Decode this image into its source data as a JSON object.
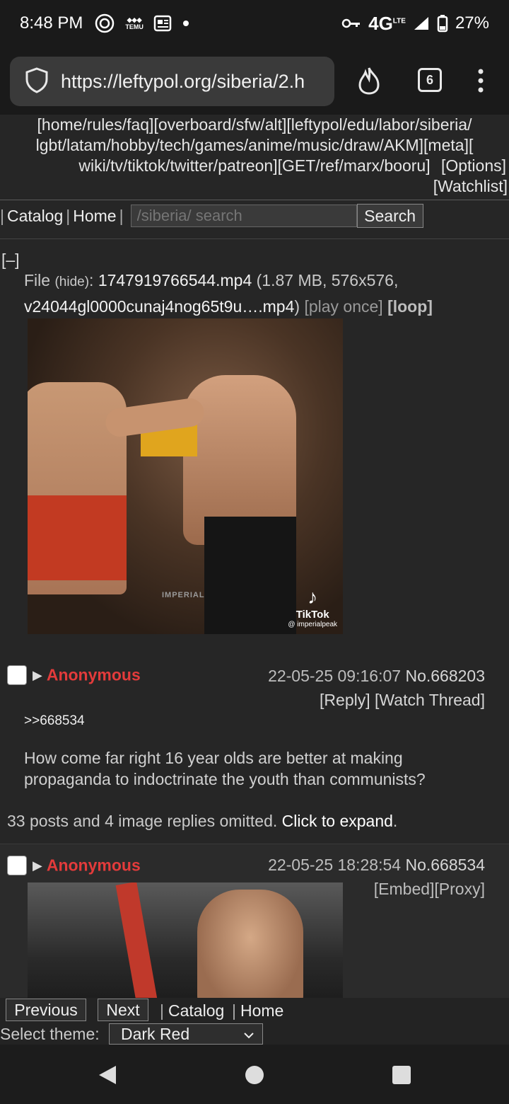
{
  "status_bar": {
    "time": "8:48 PM",
    "network": "4G",
    "network_sup": "LTE",
    "battery": "27%",
    "notif_temu": "TEMU",
    "icons": [
      "pinwheel-icon",
      "temu-icon",
      "news-icon",
      "dot-icon",
      "key-icon",
      "signal-icon",
      "battery-icon"
    ]
  },
  "browser": {
    "url": "https://leftypol.org/siberia/2.h",
    "tab_count": "6"
  },
  "boardlist": {
    "line1": "[home/rules/faq][overboard/sfw/alt][leftypol/edu/labor/siberia/",
    "line2": "lgbt/latam/hobby/tech/games/anime/music/draw/AKM][meta][",
    "line3": "wiki/tv/tiktok/twitter/patreon][GET/ref/marx/booru]",
    "options": "[Options]",
    "watchlist": "[Watchlist]"
  },
  "nav": {
    "lead_sep": "|",
    "catalog": "Catalog",
    "sep": "|",
    "home": "Home",
    "trail_sep": "|",
    "search_placeholder": "/siberia/ search",
    "search_button": "Search"
  },
  "thread": {
    "collapse": "[–]",
    "file_label": "File",
    "file_hide": "(hide)",
    "file_colon": ":",
    "file_name": "1747919766544.mp4",
    "file_meta_1": "(1.87 MB, 576x576,",
    "file_orig": "v24044gl0000cunaj4nog65t9u….mp4",
    "file_close": ")",
    "play_once": "[play once]",
    "loop": "[loop]",
    "video_watermark_tiktok": "TikTok",
    "video_watermark_handle": "@ imperialpeak",
    "video_watermark_imperial": "IMPERIAL",
    "op": {
      "name": "Anonymous",
      "date": "22-05-25 09:16:07",
      "number": "No.668203",
      "reply": "[Reply]",
      "watch": "[Watch Thread]",
      "quote": ">>668534",
      "body": "How come far right 16 year olds are better at making propaganda to indoctrinate the youth than communists?"
    },
    "omitted_text": "33 posts and 4 image replies omitted.",
    "omitted_expand": "Click to expand",
    "omitted_period": ".",
    "reply": {
      "name": "Anonymous",
      "date": "22-05-25 18:28:54",
      "number": "No.668534",
      "embed": "[Embed]",
      "proxy": "[Proxy]"
    }
  },
  "bottom": {
    "previous": "Previous",
    "next": "Next",
    "sep1": "|",
    "catalog": "Catalog",
    "sep2": "|",
    "home": "Home",
    "select_theme": "Select theme:",
    "theme_value": "Dark Red"
  },
  "colors": {
    "name_red": "#e33b3b",
    "background": "#262626"
  }
}
